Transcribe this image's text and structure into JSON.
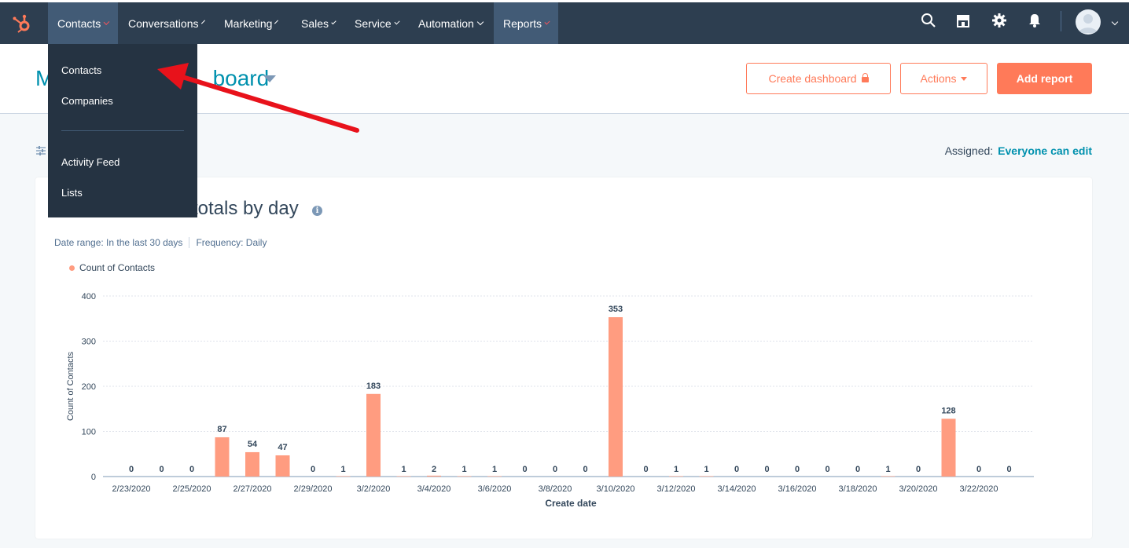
{
  "nav": {
    "items": [
      {
        "label": "Contacts",
        "accent": true,
        "active": true
      },
      {
        "label": "Conversations",
        "accent": false,
        "active": false
      },
      {
        "label": "Marketing",
        "accent": false,
        "active": false
      },
      {
        "label": "Sales",
        "accent": false,
        "active": false
      },
      {
        "label": "Service",
        "accent": false,
        "active": false
      },
      {
        "label": "Automation",
        "accent": false,
        "active": false
      },
      {
        "label": "Reports",
        "accent": true,
        "active": true
      }
    ],
    "icons": [
      "search-icon",
      "marketplace-icon",
      "settings-gear-icon",
      "notification-bell-icon"
    ]
  },
  "dropdown": {
    "items": [
      "Contacts",
      "Companies",
      "Activity Feed",
      "Lists"
    ]
  },
  "header": {
    "title": "M                          board",
    "create_dashboard": "Create dashboard",
    "actions": "Actions",
    "add_report": "Add report"
  },
  "assigned": {
    "label": "Assigned:",
    "value": "Everyone can edit"
  },
  "card": {
    "title": "totals by day",
    "date_range": "Date range: In the last 30 days",
    "frequency": "Frequency: Daily",
    "legend": "Count of Contacts"
  },
  "colors": {
    "accent": "#ff7a59",
    "bar": "#ff9c80",
    "link": "#0091ae",
    "nav": "#2d3e50"
  },
  "chart_data": {
    "type": "bar",
    "title": "totals by day",
    "xlabel": "Create date",
    "ylabel": "Count of Contacts",
    "ylim": [
      0,
      400
    ],
    "yticks": [
      0,
      100,
      200,
      300,
      400
    ],
    "grid": true,
    "legend_position": "top-left",
    "categories": [
      "2/23/2020",
      "2/24/2020",
      "2/25/2020",
      "2/26/2020",
      "2/27/2020",
      "2/28/2020",
      "2/29/2020",
      "3/1/2020",
      "3/2/2020",
      "3/3/2020",
      "3/4/2020",
      "3/5/2020",
      "3/6/2020",
      "3/7/2020",
      "3/8/2020",
      "3/9/2020",
      "3/10/2020",
      "3/11/2020",
      "3/12/2020",
      "3/13/2020",
      "3/14/2020",
      "3/15/2020",
      "3/16/2020",
      "3/17/2020",
      "3/18/2020",
      "3/19/2020",
      "3/20/2020",
      "3/21/2020",
      "3/22/2020",
      "3/23/2020"
    ],
    "xtick_labels": [
      "2/23/2020",
      "2/25/2020",
      "2/27/2020",
      "2/29/2020",
      "3/2/2020",
      "3/4/2020",
      "3/6/2020",
      "3/8/2020",
      "3/10/2020",
      "3/12/2020",
      "3/14/2020",
      "3/16/2020",
      "3/18/2020",
      "3/20/2020",
      "3/22/2020"
    ],
    "series": [
      {
        "name": "Count of Contacts",
        "values": [
          0,
          0,
          0,
          87,
          54,
          47,
          0,
          1,
          183,
          1,
          2,
          1,
          1,
          0,
          0,
          0,
          353,
          0,
          1,
          1,
          0,
          0,
          0,
          0,
          0,
          1,
          0,
          128,
          0,
          0
        ]
      }
    ]
  }
}
